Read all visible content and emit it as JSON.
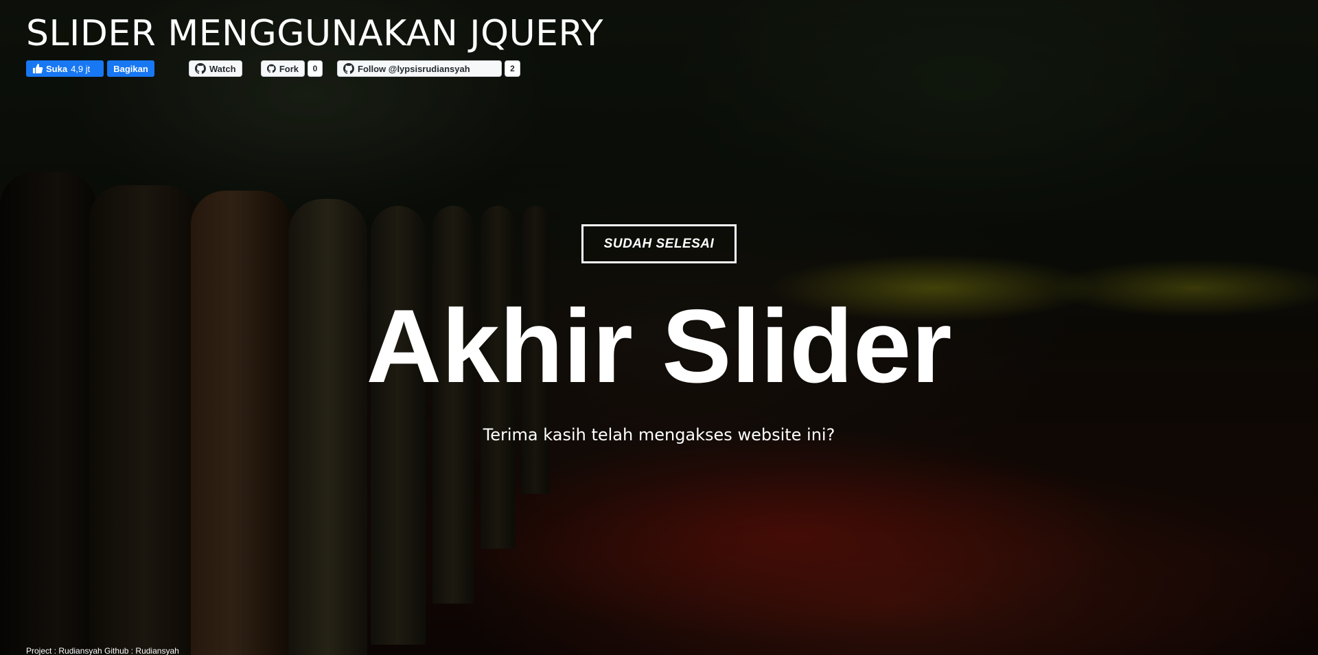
{
  "header": {
    "title": "SLIDER MENGGUNAKAN JQUERY"
  },
  "social": {
    "facebook": {
      "like_label": "Suka",
      "like_count": "4,9 jt",
      "share_label": "Bagikan",
      "color": "#1877f2"
    },
    "github": {
      "watch_label": "Watch",
      "fork_label": "Fork",
      "fork_count": "0",
      "follow_label": "Follow @lypsisrudiansyah",
      "follow_count": "2",
      "icon": "github-icon"
    }
  },
  "hero": {
    "badge": "SUDAH SELESAI",
    "title": "Akhir Slider",
    "subtitle": "Terima kasih telah mengakses website ini?"
  },
  "footer": {
    "credit": "Project : Rudiansyah Github : Rudiansyah"
  }
}
